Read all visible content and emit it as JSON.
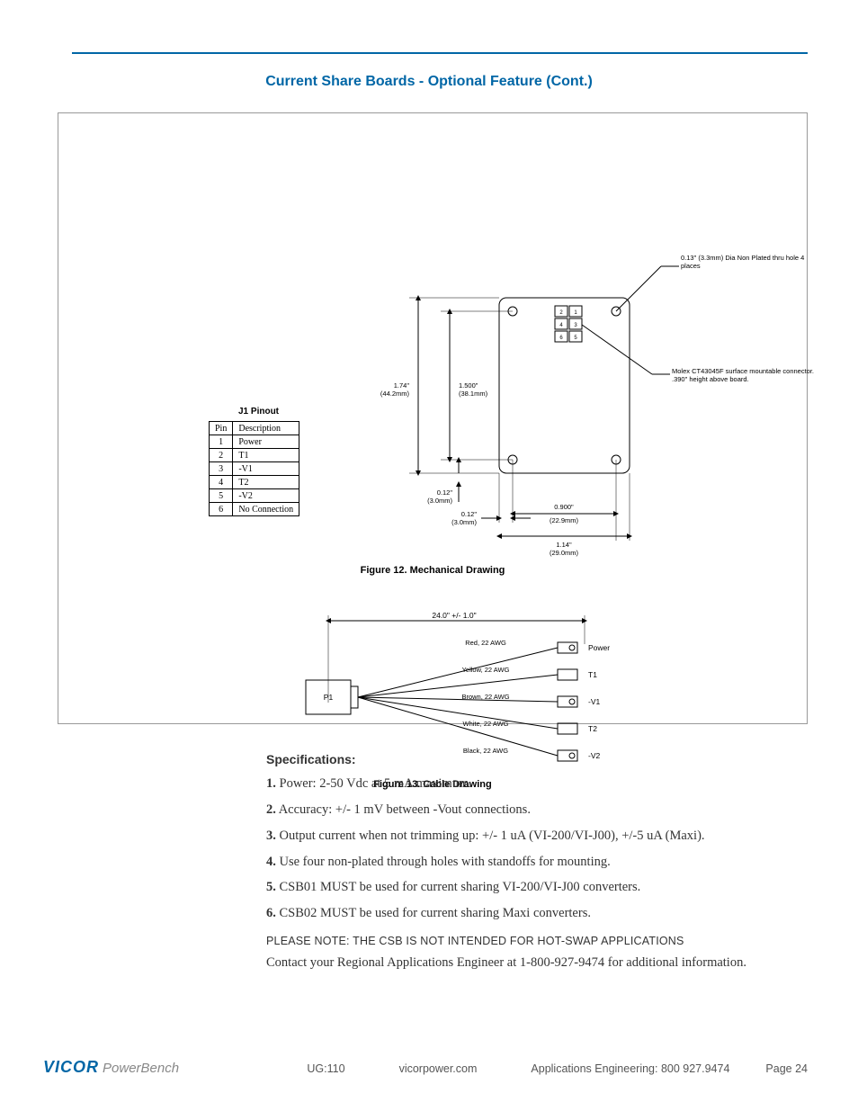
{
  "heading": "Current Share Boards - Optional Feature (Cont.)",
  "pinout": {
    "title": "J1 Pinout",
    "headers": {
      "pin": "Pin",
      "desc": "Description"
    },
    "rows": [
      {
        "pin": "1",
        "desc": "Power"
      },
      {
        "pin": "2",
        "desc": "T1"
      },
      {
        "pin": "3",
        "desc": "-V1"
      },
      {
        "pin": "4",
        "desc": "T2"
      },
      {
        "pin": "5",
        "desc": "-V2"
      },
      {
        "pin": "6",
        "desc": "No Connection"
      }
    ]
  },
  "mech": {
    "dim_h1_in": "1.74\"",
    "dim_h1_mm": "(44.2mm)",
    "dim_h2_in": "1.500\"",
    "dim_h2_mm": "(38.1mm)",
    "dim_v1_in": "0.12\"",
    "dim_v1_mm": "(3.0mm)",
    "dim_v2_in": "0.12\"",
    "dim_v2_mm": "(3.0mm)",
    "dim_w1_in": "0.900\"",
    "dim_w1_mm": "(22.9mm)",
    "dim_w2_in": "1.14\"",
    "dim_w2_mm": "(29.0mm)",
    "callout1": "0.13\" (3.3mm) Dia Non Plated thru hole 4 places",
    "callout2": "Molex CT43045F surface mountable connector.  .390\" height above board.",
    "conn_pins": [
      "2",
      "1",
      "4",
      "3",
      "6",
      "5"
    ],
    "caption": "Figure 12. Mechanical Drawing"
  },
  "cable": {
    "length": "24.0\" +/- 1.0\"",
    "p1": "P1",
    "wires": [
      {
        "color": "Red, 22 AWG",
        "label": "Power"
      },
      {
        "color": "Yellow, 22 AWG",
        "label": "T1"
      },
      {
        "color": "Brown, 22 AWG",
        "label": "-V1"
      },
      {
        "color": "White, 22 AWG",
        "label": "T2"
      },
      {
        "color": "Black, 22 AWG",
        "label": "-V2"
      }
    ],
    "caption": "Figure 13. Cable Drawing"
  },
  "specs": {
    "title": "Specifications:",
    "items": [
      "Power: 2-50 Vdc at 5 mA maximum.",
      "Accuracy: +/- 1 mV between -Vout connections.",
      "Output current when not trimming up: +/- 1 uA (VI-200/VI-J00), +/-5 uA (Maxi).",
      "Use four non-plated through holes with standoffs for mounting.",
      "CSB01 MUST be used for current sharing VI-200/VI-J00 converters.",
      "CSB02 MUST be used for current sharing Maxi converters."
    ],
    "note": "PLEASE NOTE: THE CSB IS NOT INTENDED FOR HOT-SWAP APPLICATIONS",
    "contact": "Contact your Regional Applications Engineer at 1-800-927-9474 for additional information."
  },
  "footer": {
    "logo1": "VICOR",
    "logo2": "PowerBench",
    "doc": "UG:110",
    "site": "vicorpower.com",
    "eng": "Applications Engineering: 800 927.9474",
    "page": "Page 24"
  }
}
